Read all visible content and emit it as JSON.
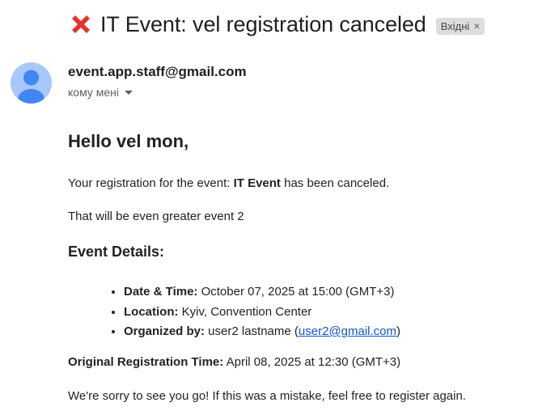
{
  "header": {
    "subject": "IT Event: vel registration canceled",
    "subject_icon": "red-cross-mark-icon",
    "label_chip": "Вхідні",
    "label_close": "×"
  },
  "sender": {
    "avatar_icon": "person-avatar-icon",
    "email": "event.app.staff@gmail.com",
    "recipient": "кому мені"
  },
  "body": {
    "greeting": "Hello vel mon,",
    "registration_prefix": "Your registration for the event: ",
    "event_name": "IT Event",
    "registration_suffix": " has been canceled.",
    "description": "That will be even greater event 2",
    "details_heading": "Event Details:",
    "details": {
      "date_label": "Date & Time:",
      "date_value": " October 07, 2025 at 15:00 (GMT+3)",
      "location_label": "Location:",
      "location_value": " Kyiv, Convention Center",
      "organizer_label": "Organized by:",
      "organizer_name": " user2 lastname (",
      "organizer_email": "user2@gmail.com",
      "organizer_close": ")"
    },
    "original_time_label": "Original Registration Time:",
    "original_time_value": " April 08, 2025 at 12:30 (GMT+3)",
    "closing": "We're sorry to see you go! If this was a mistake, feel free to register again."
  },
  "colors": {
    "accent_link": "#1155cc",
    "avatar_bg": "#a8c7fa",
    "avatar_fg": "#4285f4",
    "cross_red": "#e5332a"
  }
}
